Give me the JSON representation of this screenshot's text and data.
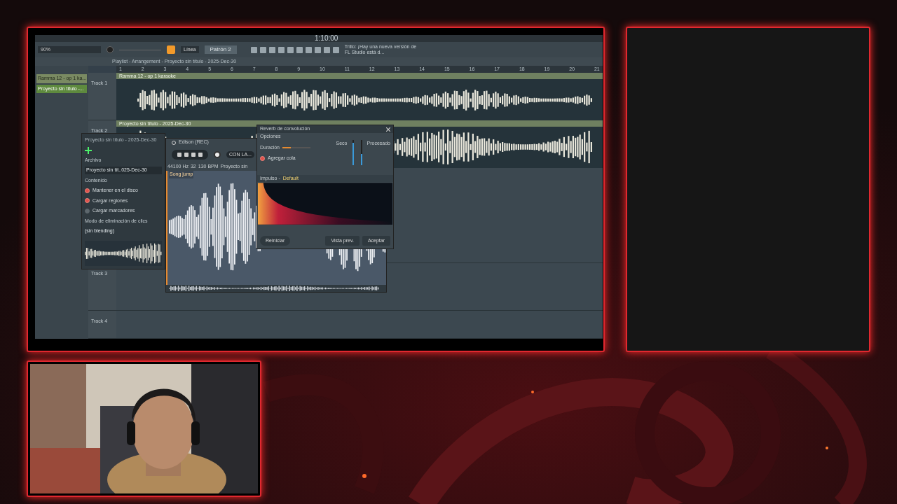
{
  "daw": {
    "toolbar": {
      "zoom": "90%",
      "snap": "Línea",
      "pattern": "Patrón 2",
      "time": "1:10:00",
      "hint": "Trillo: ¡Hay una nueva versión de FL Studio está d..."
    },
    "playlist": {
      "title": "Playlist - Arrangement - Proyecto sin título - 2025-Dec-30",
      "ruler": [
        "1",
        "2",
        "3",
        "4",
        "5",
        "6",
        "7",
        "8",
        "9",
        "10",
        "11",
        "12",
        "13",
        "14",
        "15",
        "16",
        "17",
        "18",
        "19",
        "20",
        "21"
      ],
      "picker": [
        {
          "label": "Ramma 12 - op 1 ka...",
          "selected": false
        },
        {
          "label": "Proyecto sin título -...",
          "selected": true
        }
      ],
      "tracks": [
        {
          "name": "Track 1",
          "clip": "Ramma 12 - op 1 karaoke"
        },
        {
          "name": "Track 2",
          "clip": "Proyecto sin título - 2025-Dec-30"
        },
        {
          "name": "Track 3"
        },
        {
          "name": "Track 4"
        }
      ]
    },
    "browser": {
      "title": "Proyecto sin título - 2025-Dec-30",
      "file_label": "Archivo",
      "file_value": "Proyecto sin tít..025-Dec-30",
      "section": "Contenido",
      "options": [
        {
          "label": "Mantener en el disco",
          "checked": true
        },
        {
          "label": "Cargar regiones",
          "checked": true
        },
        {
          "label": "Cargar marcadores",
          "checked": false
        }
      ],
      "mode_label": "Modo de eliminación de clics",
      "mode_value": "(sin blending)"
    },
    "edison": {
      "title": "Edison (REC)",
      "button": "CON LA...",
      "rate": "44100 Hz",
      "bits": "32",
      "tempo": "130 BPM",
      "name": "Proyecto sin",
      "marker": "Song jump"
    },
    "reverb": {
      "title": "Reverb de convolución",
      "section": "Opciones",
      "slider_label": "Duración",
      "slider": {
        "level": 0.3
      },
      "dry_label": "Seco",
      "dry": {
        "level": 0.9
      },
      "wet_label": "Procesado",
      "wet": {
        "level": 0.45
      },
      "options": [
        {
          "label": "Agregar cola",
          "checked": true
        }
      ],
      "impulse_label": "Impulso -",
      "impulse_name": "Default",
      "buttons": [
        {
          "label": "Reiniciar",
          "kind": "left"
        },
        {
          "label": "Vista prev.",
          "kind": "right"
        },
        {
          "label": "Aceptar",
          "kind": "right"
        }
      ]
    }
  }
}
